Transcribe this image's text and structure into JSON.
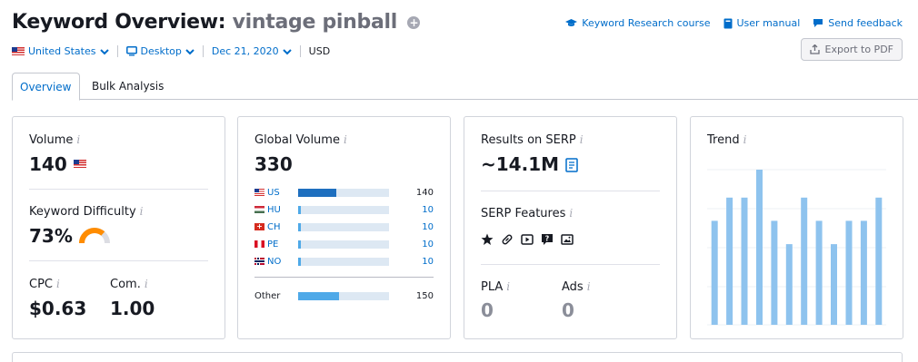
{
  "header": {
    "title": "Keyword Overview:",
    "keyword": "vintage pinball",
    "links": [
      {
        "label": "Keyword Research course",
        "icon": "graduation-cap-icon"
      },
      {
        "label": "User manual",
        "icon": "book-icon"
      },
      {
        "label": "Send feedback",
        "icon": "speech-bubble-icon"
      }
    ],
    "export_label": "Export to PDF"
  },
  "filters": {
    "country": "United States",
    "device": "Desktop",
    "date": "Dec 21, 2020",
    "currency": "USD"
  },
  "tabs": [
    {
      "label": "Overview",
      "active": true
    },
    {
      "label": "Bulk Analysis",
      "active": false
    }
  ],
  "volume": {
    "label": "Volume",
    "value": "140"
  },
  "difficulty": {
    "label": "Keyword Difficulty",
    "value": "73%",
    "percent": 73,
    "color": "#ff8c00"
  },
  "cpc": {
    "label": "CPC",
    "value": "$0.63"
  },
  "competition": {
    "label": "Com.",
    "value": "1.00"
  },
  "global_volume": {
    "label": "Global Volume",
    "value": "330",
    "rows": [
      {
        "code": "US",
        "value": "140",
        "share": 0.42,
        "color": "#1e6fbf"
      },
      {
        "code": "HU",
        "value": "10",
        "share": 0.03,
        "color": "#4fa9e8"
      },
      {
        "code": "CH",
        "value": "10",
        "share": 0.03,
        "color": "#4fa9e8"
      },
      {
        "code": "PE",
        "value": "10",
        "share": 0.03,
        "color": "#4fa9e8"
      },
      {
        "code": "NO",
        "value": "10",
        "share": 0.03,
        "color": "#4fa9e8"
      }
    ],
    "other": {
      "label": "Other",
      "value": "150",
      "share": 0.45,
      "color": "#4fa9e8"
    }
  },
  "serp": {
    "results_label": "Results on SERP",
    "results_value": "~14.1M",
    "features_label": "SERP Features",
    "features_icons": [
      "star-icon",
      "link-icon",
      "video-icon",
      "faq-icon",
      "image-icon"
    ],
    "pla_label": "PLA",
    "pla_value": "0",
    "ads_label": "Ads",
    "ads_value": "0"
  },
  "trend": {
    "label": "Trend",
    "bar_color": "#8ec3ee",
    "values": [
      0.67,
      0.82,
      0.82,
      1.0,
      0.67,
      0.52,
      0.82,
      0.67,
      0.52,
      0.67,
      0.67,
      0.82
    ]
  }
}
